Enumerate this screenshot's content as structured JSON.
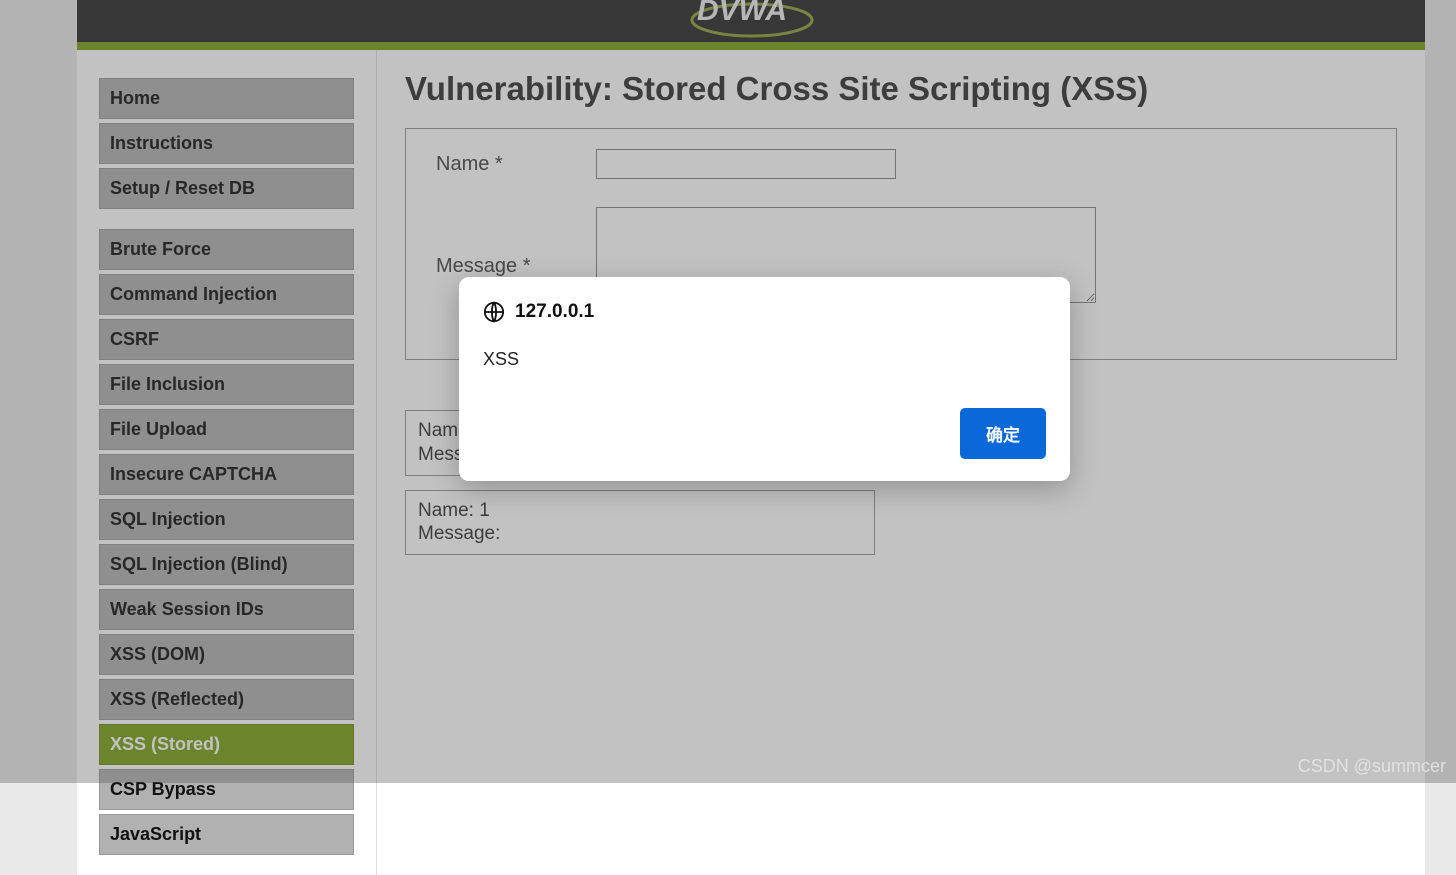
{
  "header": {
    "logo_text": "DVWA"
  },
  "sidebar": {
    "group1": [
      {
        "label": "Home"
      },
      {
        "label": "Instructions"
      },
      {
        "label": "Setup / Reset DB"
      }
    ],
    "group2": [
      {
        "label": "Brute Force"
      },
      {
        "label": "Command Injection"
      },
      {
        "label": "CSRF"
      },
      {
        "label": "File Inclusion"
      },
      {
        "label": "File Upload"
      },
      {
        "label": "Insecure CAPTCHA"
      },
      {
        "label": "SQL Injection"
      },
      {
        "label": "SQL Injection (Blind)"
      },
      {
        "label": "Weak Session IDs"
      },
      {
        "label": "XSS (DOM)"
      },
      {
        "label": "XSS (Reflected)"
      },
      {
        "label": "XSS (Stored)",
        "active": true
      },
      {
        "label": "CSP Bypass"
      },
      {
        "label": "JavaScript"
      }
    ]
  },
  "main": {
    "title": "Vulnerability: Stored Cross Site Scripting (XSS)",
    "form": {
      "name_label": "Name *",
      "message_label": "Message *",
      "name_value": "",
      "message_value": ""
    },
    "entries": [
      {
        "name_label": "Name:",
        "name_value": "",
        "msg_label": "Message:",
        "msg_value": ""
      },
      {
        "name_label": "Name:",
        "name_value": "1",
        "msg_label": "Message:",
        "msg_value": ""
      }
    ]
  },
  "dialog": {
    "origin": "127.0.0.1",
    "message": "XSS",
    "ok_label": "确定"
  },
  "watermark": "CSDN @summcer"
}
